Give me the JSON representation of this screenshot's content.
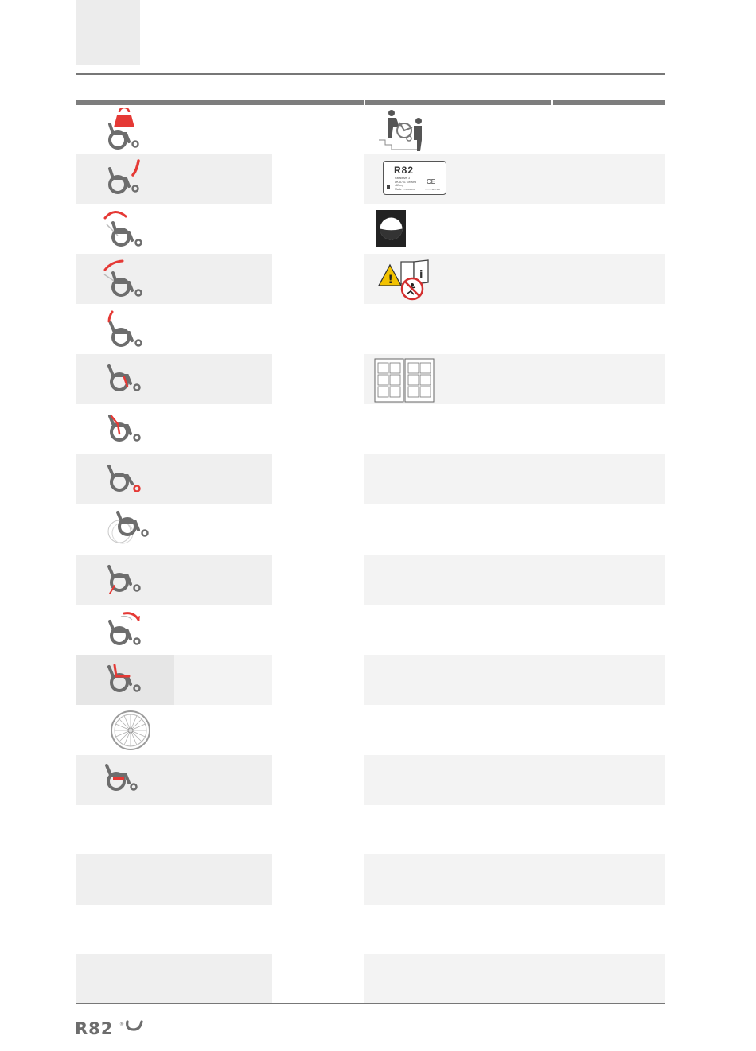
{
  "brand": {
    "logo_text": "R82",
    "accent_color": "#e53935",
    "icon_grey": "#6d6d6d"
  },
  "left_icons": [
    "wheelchair-weight-icon",
    "wheelchair-push-handle-icon",
    "wheelchair-backrest-tilt-icon",
    "wheelchair-backrest-recline-icon",
    "wheelchair-backrest-height-icon",
    "wheelchair-seat-depth-icon",
    "wheelchair-armrest-icon",
    "wheelchair-front-castor-icon",
    "wheelchair-wheel-position-icon",
    "wheelchair-footrest-icon",
    "wheelchair-tilt-in-space-icon",
    "wheelchair-seat-icon",
    "spoked-wheel-icon",
    "wheelchair-brake-icon"
  ],
  "right_icons": [
    "carrying-on-stairs-icon",
    "product-label-icon",
    "washing-symbol-icon",
    "warning-manual-icon",
    "",
    "user-manual-pages-icon"
  ],
  "product_label": {
    "brand": "R82",
    "lines": [
      "Parallelvej 3",
      "DK-8751 Gedved",
      "r82.org",
      "Made in xxxxxxx"
    ],
    "ce_mark": "CE",
    "code": "YYYY-MM-DD"
  }
}
